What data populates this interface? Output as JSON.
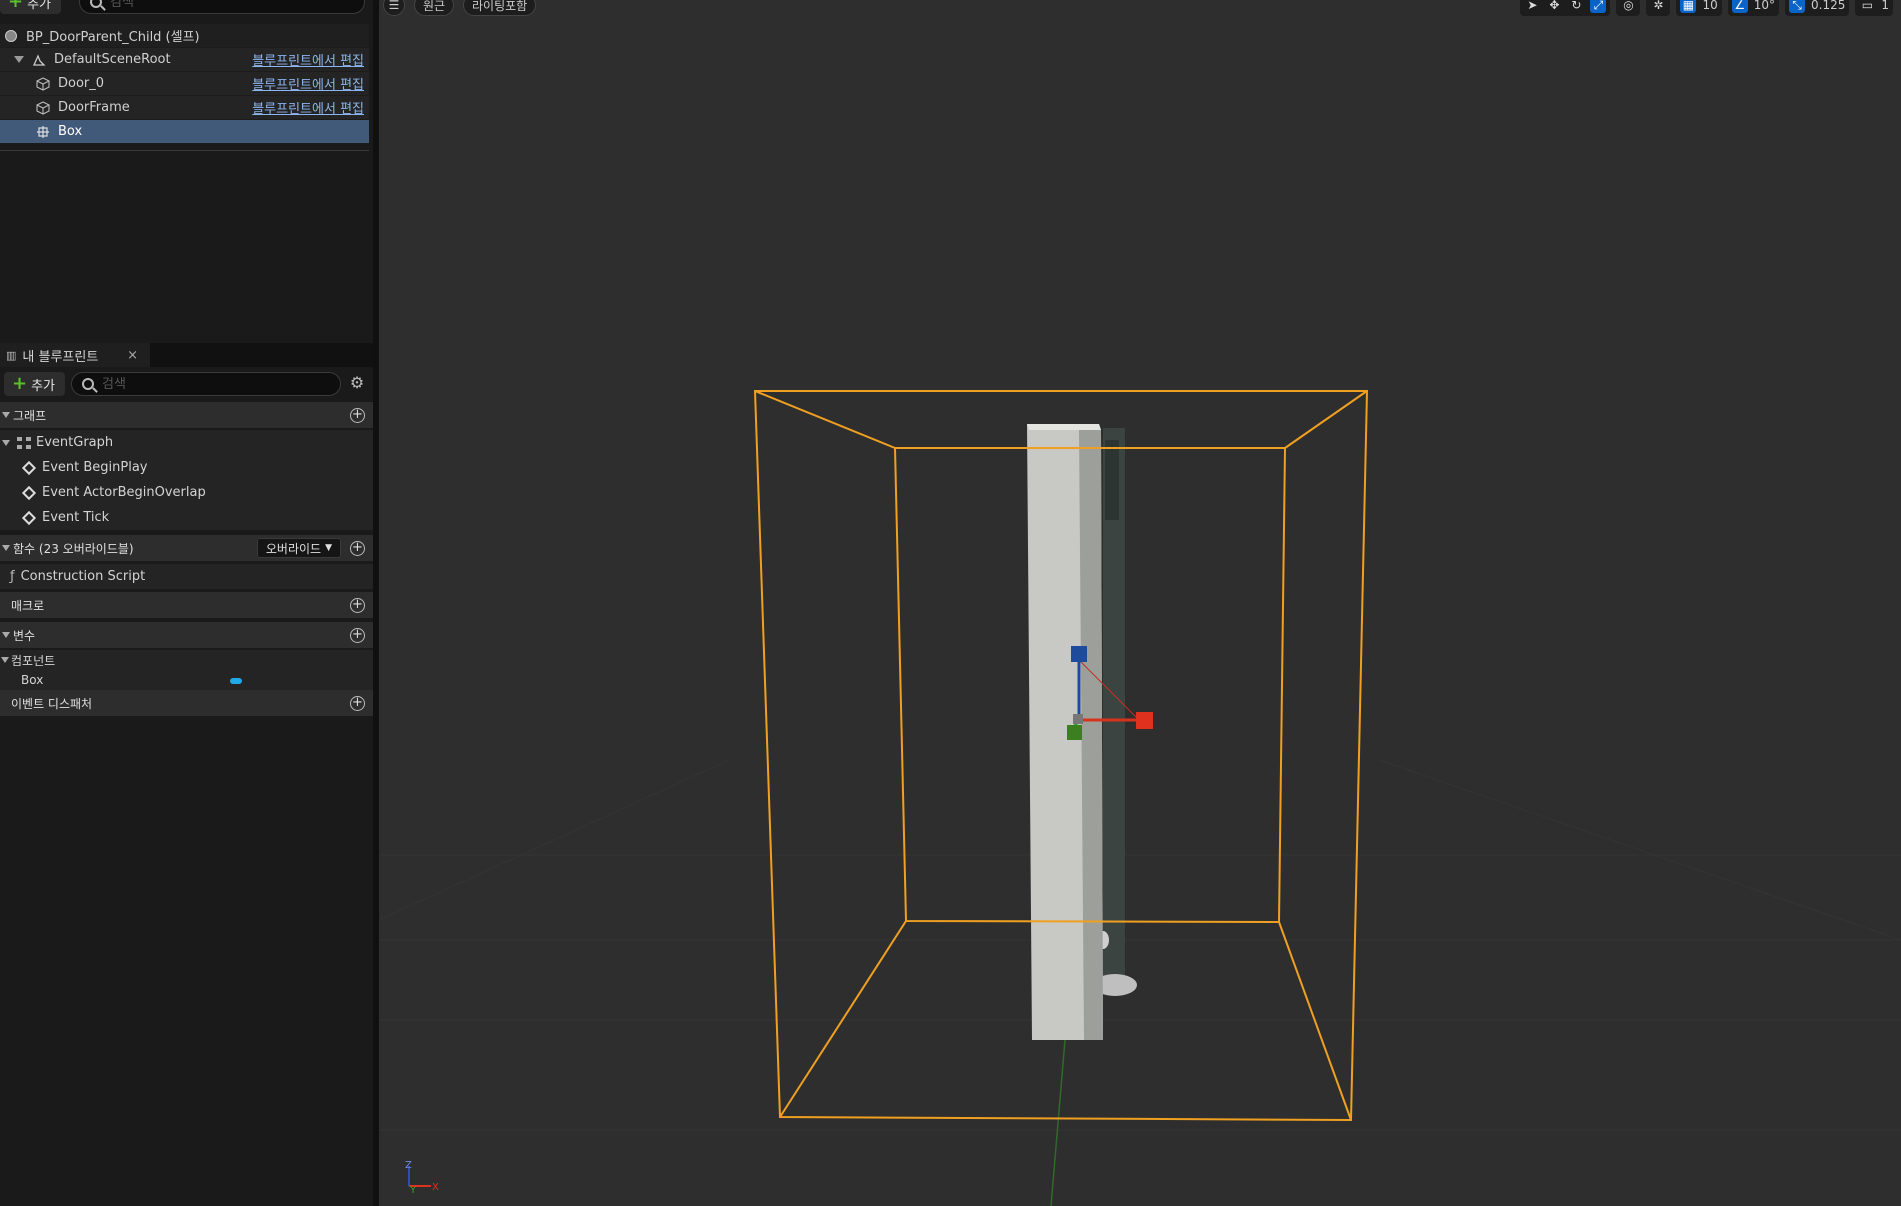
{
  "components": {
    "add_label": "추가",
    "search_placeholder": "검색",
    "tree": [
      {
        "label": "BP_DoorParent_Child (셀프)",
        "link": ""
      },
      {
        "label": "DefaultSceneRoot",
        "link": "블루프린트에서 편집"
      },
      {
        "label": "Door_0",
        "link": "블루프린트에서 편집"
      },
      {
        "label": "DoorFrame",
        "link": "블루프린트에서 편집"
      },
      {
        "label": "Box",
        "link": ""
      }
    ]
  },
  "my_blueprint": {
    "tab_label": "내 블루프린트",
    "close_glyph": "×",
    "add_label": "추가",
    "search_placeholder": "검색",
    "sections": {
      "graph": "그래프",
      "functions": "함수 (23 오버라이드블)",
      "override_label": "오버라이드",
      "macros": "매크로",
      "variables": "변수",
      "components_cat": "컴포넌트",
      "event_dispatchers": "이벤트 디스패처"
    },
    "event_graph": "EventGraph",
    "events": [
      "Event BeginPlay",
      "Event ActorBeginOverlap",
      "Event Tick"
    ],
    "construction_script": "Construction Script",
    "variables": [
      {
        "label": "Box",
        "color": "#1fa9e9"
      }
    ]
  },
  "viewport": {
    "view_mode": "원근",
    "lighting": "라이팅포함",
    "grid_snap": "10",
    "rotation_snap": "10°",
    "scale_snap": "0.125",
    "camera_speed": "1",
    "axis_labels": {
      "x": "X",
      "y": "Y",
      "z": "Z"
    },
    "colors": {
      "background": "#2e2e2e",
      "selection_box": "#f0a020",
      "axis_x": "#e0301e",
      "axis_y": "#2fa62b",
      "axis_z": "#2e4fb8"
    }
  }
}
